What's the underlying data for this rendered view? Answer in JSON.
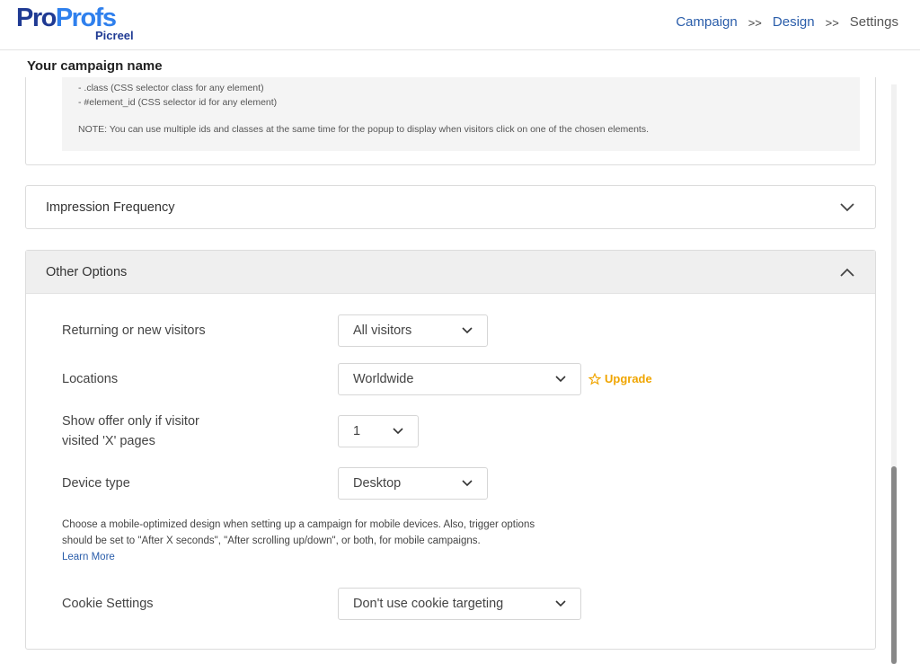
{
  "logo": {
    "part1": "Pro",
    "part2": "Profs",
    "product": "Picreel"
  },
  "breadcrumb": {
    "step1": "Campaign",
    "sep1": ">>",
    "step2": "Design",
    "sep2": ">>",
    "step3": "Settings"
  },
  "campaign_name": "Your campaign name",
  "selector_note": {
    "line1": "- .class (CSS selector class for any element)",
    "line2": "- #element_id (CSS selector id for any element)",
    "line3": "NOTE: You can use multiple ids and classes at the same time for the popup to display when visitors click on one of the chosen elements."
  },
  "impression_section": {
    "title": "Impression Frequency"
  },
  "other_section": {
    "title": "Other Options",
    "returning": {
      "label": "Returning or new visitors",
      "value": "All visitors"
    },
    "locations": {
      "label": "Locations",
      "value": "Worldwide",
      "upgrade_label": "Upgrade"
    },
    "visited_pages": {
      "label_line1": "Show offer only if visitor",
      "label_line2": "visited 'X' pages",
      "value": "1"
    },
    "device": {
      "label": "Device type",
      "value": "Desktop"
    },
    "mobile_note": "Choose a mobile-optimized design when setting up a campaign for mobile devices. Also, trigger options should be set to \"After X seconds\", \"After scrolling up/down\", or both, for mobile campaigns.",
    "learn_more": "Learn More",
    "cookie": {
      "label": "Cookie Settings",
      "value": "Don't use cookie targeting"
    }
  },
  "colors": {
    "brand_dark": "#1f3a93",
    "brand_light": "#2f80ed",
    "upgrade": "#f0a500",
    "link": "#2a5daa"
  }
}
